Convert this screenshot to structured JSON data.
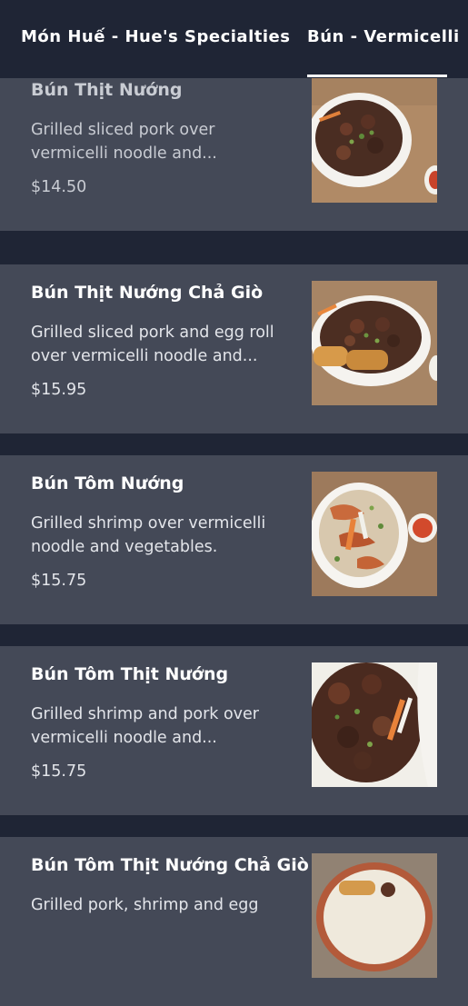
{
  "tabs": [
    {
      "label": "Món Huế - Hue's Specialties",
      "active": false
    },
    {
      "label": "Bún - Vermicelli",
      "active": true
    }
  ],
  "items": [
    {
      "name": "Bún Thịt Nướng",
      "description": "Grilled sliced pork over vermicelli noodle and...",
      "price": "$14.50",
      "image": "grilled-pork-vermicelli-bowl-photo"
    },
    {
      "name": "Bún Thịt Nướng Chả Giò",
      "description": "Grilled sliced pork and egg roll over vermicelli noodle and...",
      "price": "$15.95",
      "image": "pork-eggroll-vermicelli-bowl-photo"
    },
    {
      "name": "Bún Tôm Nướng",
      "description": "Grilled shrimp over vermicelli noodle and vegetables.",
      "price": "$15.75",
      "image": "grilled-shrimp-vermicelli-bowl-photo"
    },
    {
      "name": "Bún Tôm Thịt Nướng",
      "description": "Grilled shrimp and pork over vermicelli noodle and...",
      "price": "$15.75",
      "image": "shrimp-pork-vermicelli-bowl-photo"
    },
    {
      "name": "Bún Tôm Thịt Nướng Chả Giò",
      "description": "Grilled pork, shrimp and egg",
      "price": "",
      "image": "combo-vermicelli-bowl-photo"
    }
  ],
  "colors": {
    "header_bg": "#1f2535",
    "card_bg": "#444957",
    "separator": "#1f2535",
    "text_primary": "#ffffff",
    "text_secondary": "#e3e5ea"
  }
}
